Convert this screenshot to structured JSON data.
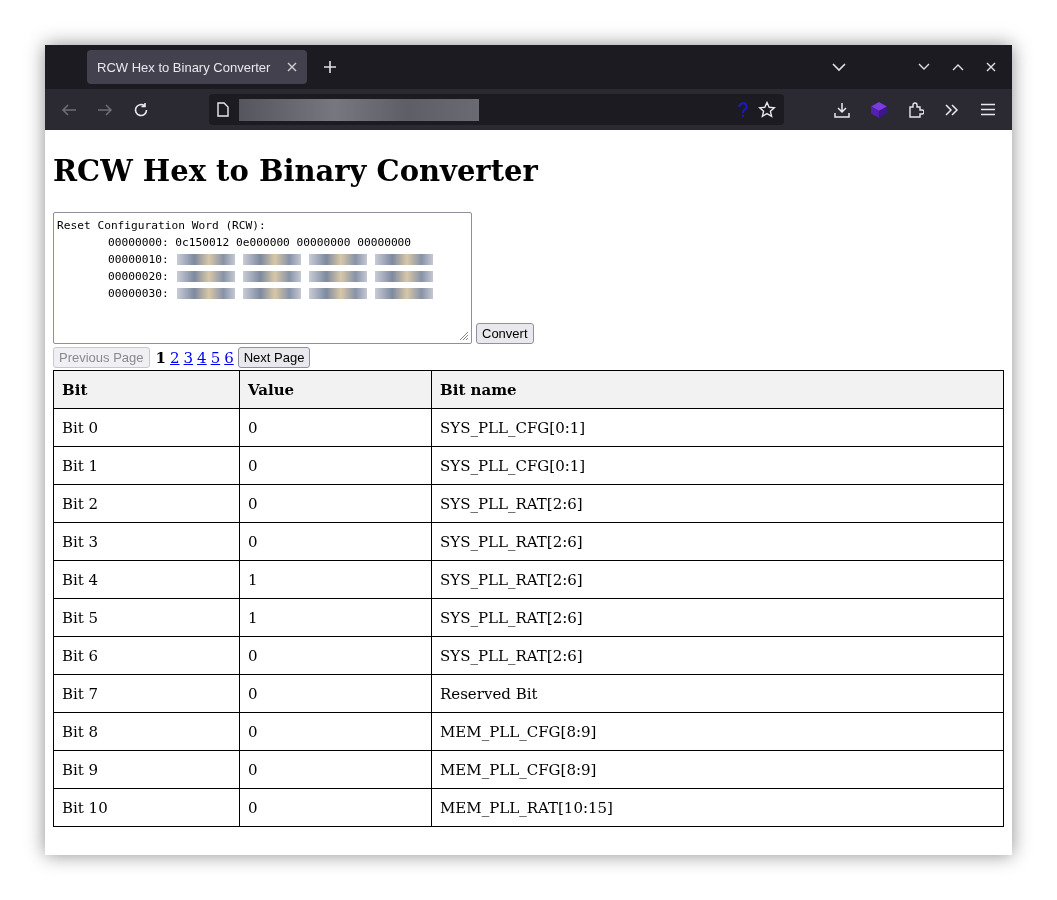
{
  "browser": {
    "tabs": [
      {
        "title": "RCW Hex to Binary Converter",
        "selected": true
      }
    ]
  },
  "page": {
    "heading": "RCW Hex to Binary Converter",
    "rcw_input": {
      "lines": [
        {
          "text": "Reset Configuration Word (RCW):",
          "redacted": false
        },
        {
          "text": "00000000: 0c150012 0e000000 00000000 00000000",
          "redacted": false
        },
        {
          "text": "00000010:",
          "redacted": true
        },
        {
          "text": "00000020:",
          "redacted": true
        },
        {
          "text": "00000030:",
          "redacted": true
        }
      ]
    },
    "convert_button": "Convert",
    "pagination": {
      "previous": "Previous Page",
      "previous_disabled": true,
      "next": "Next Page",
      "pages": [
        {
          "label": "1",
          "selected": true
        },
        {
          "label": "2",
          "selected": false
        },
        {
          "label": "3",
          "selected": false
        },
        {
          "label": "4",
          "selected": false
        },
        {
          "label": "5",
          "selected": false
        },
        {
          "label": "6",
          "selected": false
        }
      ]
    },
    "table": {
      "columns": [
        "Bit",
        "Value",
        "Bit name"
      ],
      "rows": [
        [
          "Bit 0",
          "0",
          "SYS_PLL_CFG[0:1]"
        ],
        [
          "Bit 1",
          "0",
          "SYS_PLL_CFG[0:1]"
        ],
        [
          "Bit 2",
          "0",
          "SYS_PLL_RAT[2:6]"
        ],
        [
          "Bit 3",
          "0",
          "SYS_PLL_RAT[2:6]"
        ],
        [
          "Bit 4",
          "1",
          "SYS_PLL_RAT[2:6]"
        ],
        [
          "Bit 5",
          "1",
          "SYS_PLL_RAT[2:6]"
        ],
        [
          "Bit 6",
          "0",
          "SYS_PLL_RAT[2:6]"
        ],
        [
          "Bit 7",
          "0",
          "Reserved Bit"
        ],
        [
          "Bit 8",
          "0",
          "MEM_PLL_CFG[8:9]"
        ],
        [
          "Bit 9",
          "0",
          "MEM_PLL_CFG[8:9]"
        ],
        [
          "Bit 10",
          "0",
          "MEM_PLL_RAT[10:15]"
        ]
      ]
    }
  }
}
